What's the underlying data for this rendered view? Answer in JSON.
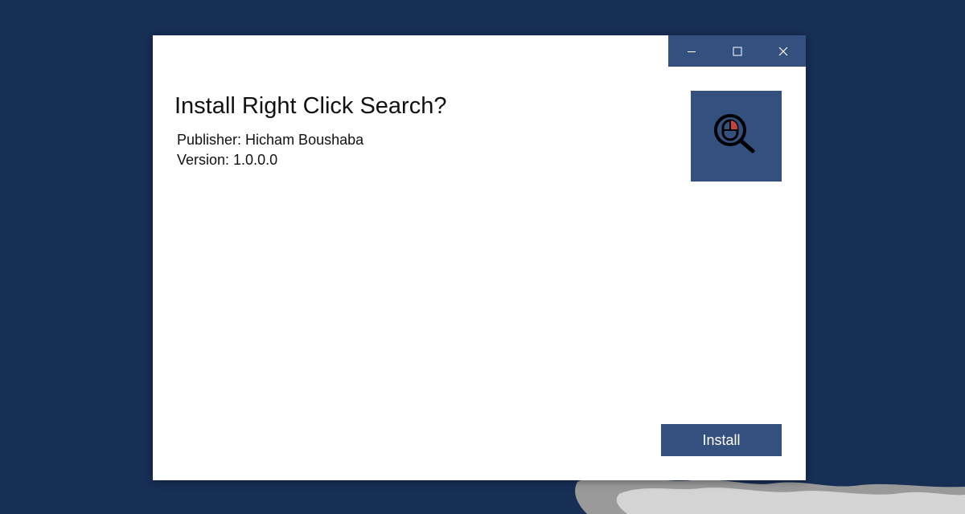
{
  "window": {
    "caption": {
      "minimize_icon": "minimize-icon",
      "maximize_icon": "maximize-icon",
      "close_icon": "close-icon"
    },
    "title": "Install Right Click Search?",
    "publisher": "Publisher: Hicham Boushaba",
    "version": "Version: 1.0.0.0",
    "app_icon": "mouse-magnifier-icon",
    "install_label": "Install"
  },
  "colors": {
    "desktop_background": "#172e55",
    "accent": "#33507f",
    "window_background": "#ffffff",
    "text": "#111111"
  }
}
